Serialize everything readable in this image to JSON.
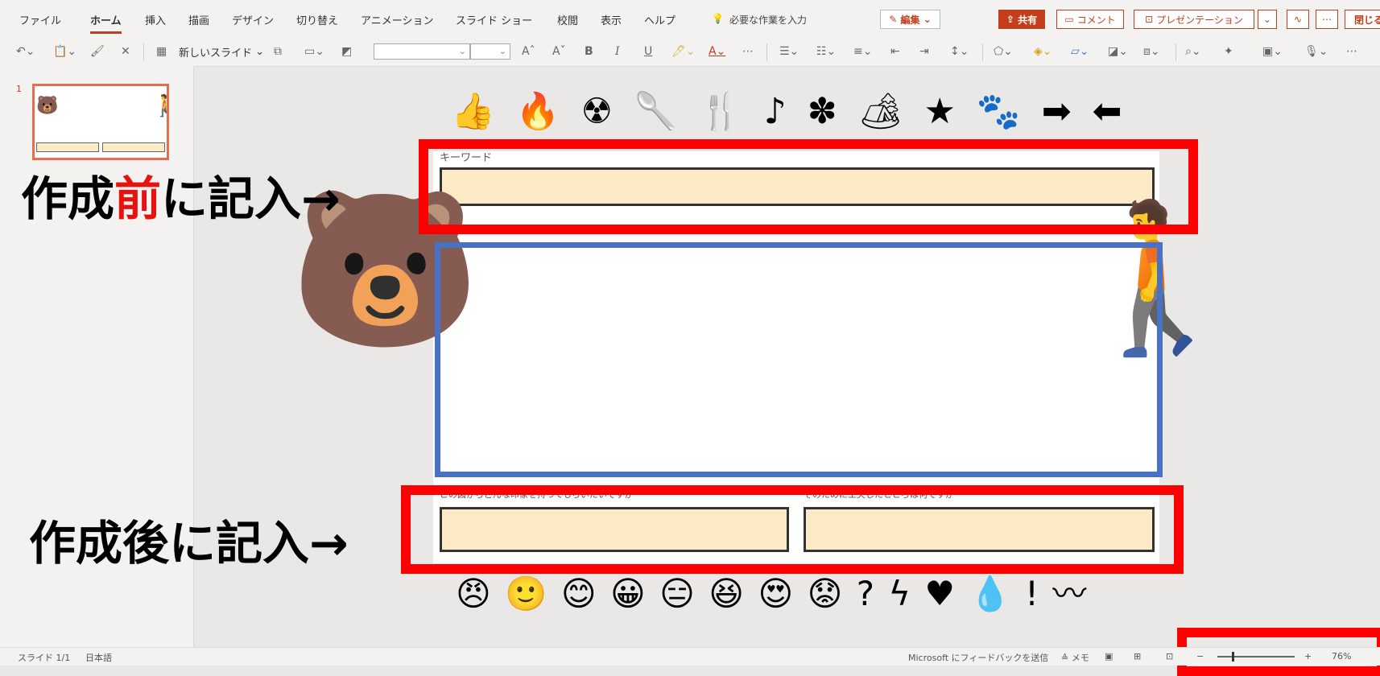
{
  "menu": {
    "tabs": [
      "ファイル",
      "ホーム",
      "挿入",
      "描画",
      "デザイン",
      "切り替え",
      "アニメーション",
      "スライド ショー",
      "校閲",
      "表示",
      "ヘルプ"
    ],
    "active_tab": "ホーム",
    "search_placeholder": "必要な作業を入力",
    "edit_label": "編集",
    "share_label": "共有",
    "comment_label": "コメント",
    "present_label": "プレゼンテーション",
    "close_label": "閉じる"
  },
  "ribbon": {
    "new_slide_label": "新しいスライド",
    "font_grow": "Aˆ",
    "font_shrink": "Aˇ",
    "bold": "B",
    "italic": "I",
    "underline": "U",
    "font_color": "A",
    "more": "⋯"
  },
  "thumbnails": [
    {
      "number": "1"
    }
  ],
  "slide": {
    "keyword_label": "キーワード",
    "impression_label": "この図からどんな印象を持ってもらいたいですか",
    "effort_label": "そのために工夫したところは何ですか",
    "icons_top": [
      "👍",
      "🔥",
      "☢",
      "🥄",
      "🍴",
      "♪",
      "✽",
      "🏕",
      "★",
      "🐾",
      "➡",
      "⬅"
    ],
    "icons_bottom": [
      "😠",
      "🙂",
      "😊",
      "😀",
      "😑",
      "😆",
      "😍",
      "😟",
      "?",
      "ϟ",
      "♥",
      "💧",
      "!",
      "〰"
    ]
  },
  "annotations": {
    "before_prefix": "作成",
    "before_highlight": "前",
    "before_suffix": "に記入→",
    "after_text": "作成後に記入→",
    "highlight_color": "#e6120d",
    "box_color": "#ff0000",
    "blue_box_color": "#4a72c4"
  },
  "status": {
    "slide_info": "スライド 1/1",
    "language": "日本語",
    "feedback": "Microsoft にフィードバックを送信",
    "notes": "メモ",
    "zoom": "76%",
    "zoom_plus": "+",
    "zoom_minus": "−"
  }
}
